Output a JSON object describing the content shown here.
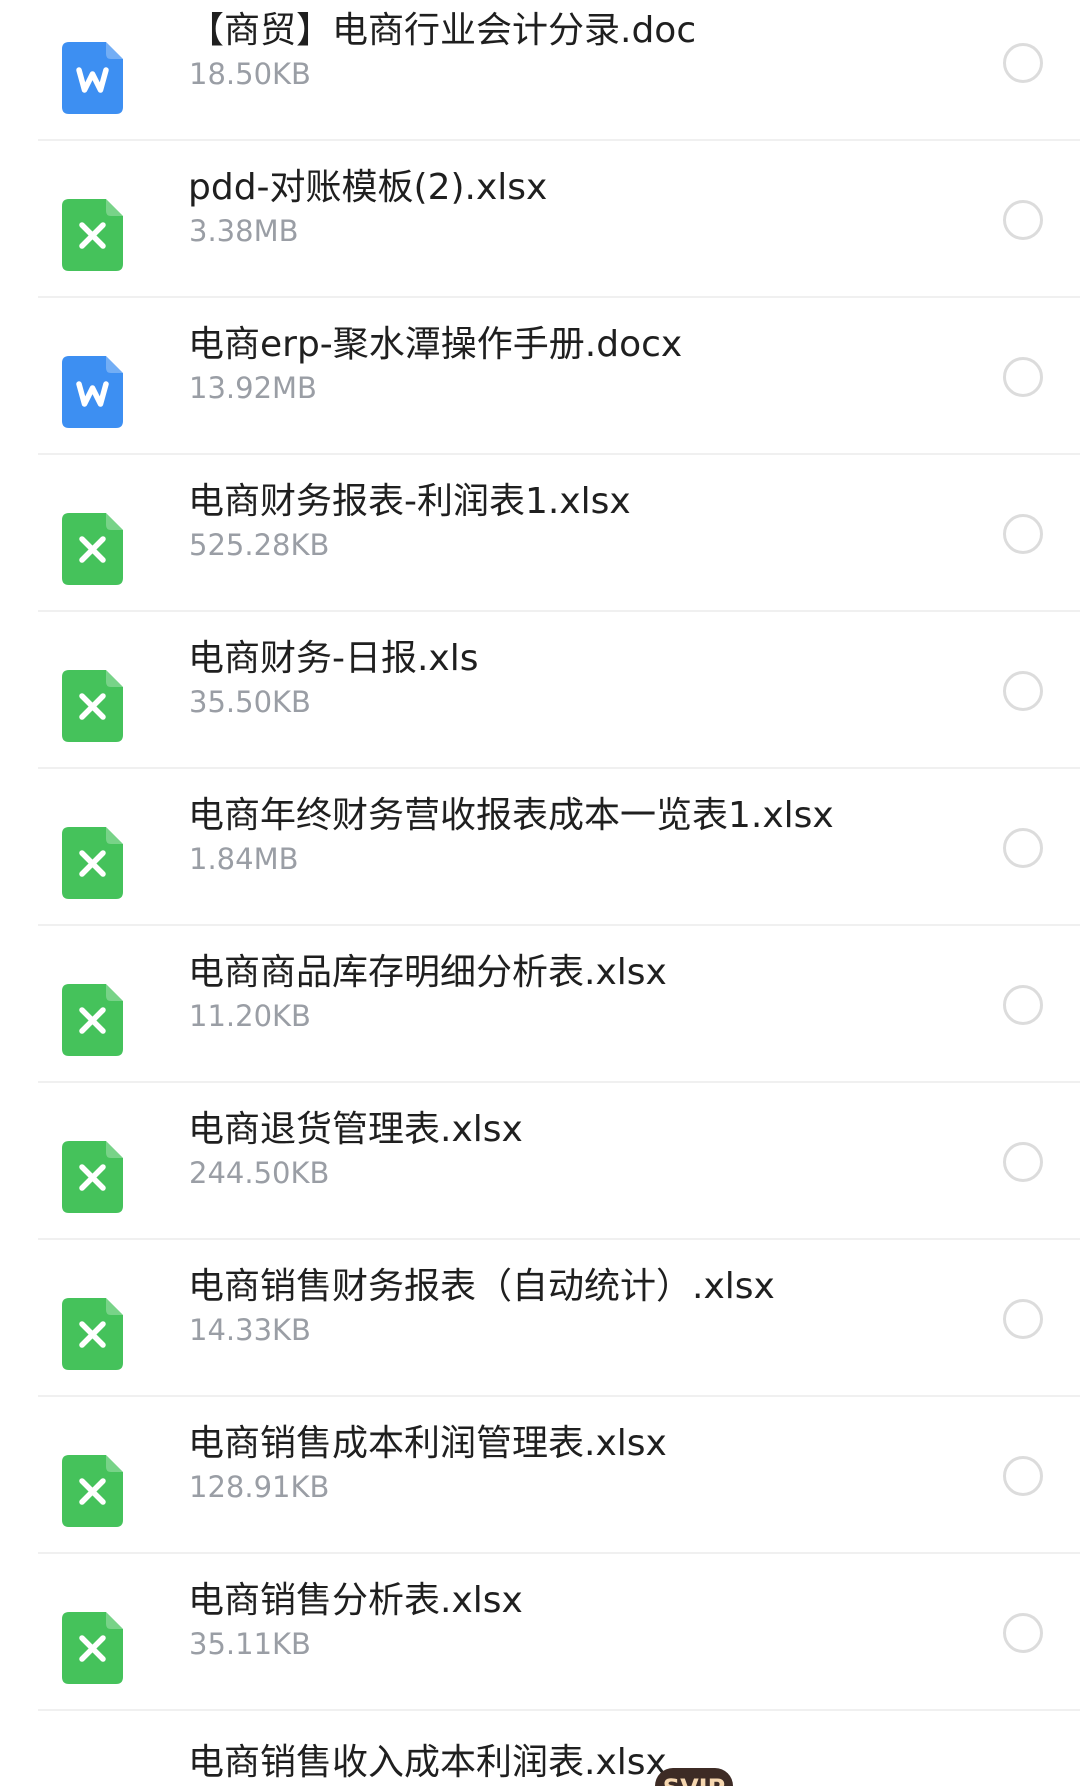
{
  "files": [
    {
      "name": "【商贸】电商行业会计分录.doc",
      "size": "18.50KB",
      "type": "word",
      "icon": "word-doc-icon"
    },
    {
      "name": "pdd-对账模板(2).xlsx",
      "size": "3.38MB",
      "type": "excel",
      "icon": "excel-sheet-icon"
    },
    {
      "name": "电商erp-聚水潭操作手册.docx",
      "size": "13.92MB",
      "type": "word",
      "icon": "word-doc-icon"
    },
    {
      "name": "电商财务报表-利润表1.xlsx",
      "size": "525.28KB",
      "type": "excel",
      "icon": "excel-sheet-icon"
    },
    {
      "name": "电商财务-日报.xls",
      "size": "35.50KB",
      "type": "excel",
      "icon": "excel-sheet-icon"
    },
    {
      "name": "电商年终财务营收报表成本一览表1.xlsx",
      "size": "1.84MB",
      "type": "excel",
      "icon": "excel-sheet-icon"
    },
    {
      "name": "电商商品库存明细分析表.xlsx",
      "size": "11.20KB",
      "type": "excel",
      "icon": "excel-sheet-icon"
    },
    {
      "name": "电商退货管理表.xlsx",
      "size": "244.50KB",
      "type": "excel",
      "icon": "excel-sheet-icon"
    },
    {
      "name": "电商销售财务报表（自动统计）.xlsx",
      "size": "14.33KB",
      "type": "excel",
      "icon": "excel-sheet-icon"
    },
    {
      "name": "电商销售成本利润管理表.xlsx",
      "size": "128.91KB",
      "type": "excel",
      "icon": "excel-sheet-icon"
    },
    {
      "name": "电商销售分析表.xlsx",
      "size": "35.11KB",
      "type": "excel",
      "icon": "excel-sheet-icon"
    }
  ],
  "partial_file": {
    "name": "电商销售收入成本利润表.xlsx"
  },
  "badge": {
    "label": "SVIP"
  },
  "colors": {
    "word_blue": "#3d8ff2",
    "excel_green": "#45c25b",
    "size_gray": "#9a9ea5",
    "radio_border": "#dcdcdc"
  }
}
